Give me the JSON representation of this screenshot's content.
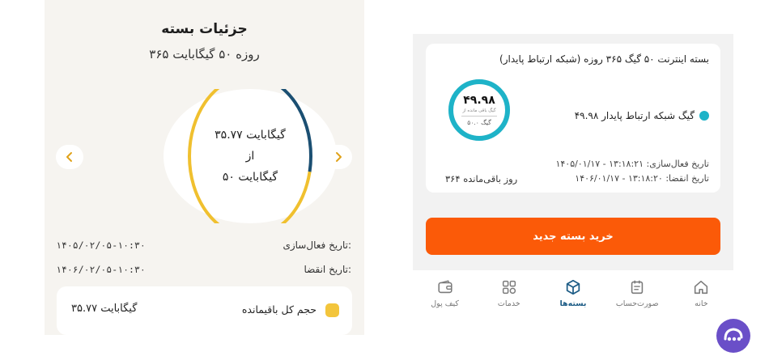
{
  "left": {
    "title": "جزئیات بسته",
    "subtitle": "۳۶۵ روزه ۵۰ گیگابایت",
    "ring": {
      "remaining_text": "۳۵.۷۷ گیگابایت",
      "of_text": "از",
      "total_text": "۵۰ گیگابایت",
      "remaining_fraction": 0.715,
      "used_color": "#1b4f72",
      "remaining_color": "#f0c02f"
    },
    "activation": {
      "label": "تاریخ فعال‌سازی:",
      "value": "۱۴۰۵/۰۲/۰۵-۱۰:۳۰"
    },
    "expiry": {
      "label": "تاریخ انقضا:",
      "value": "۱۴۰۶/۰۲/۰۵-۱۰:۳۰"
    },
    "volume": {
      "label": "حجم کل باقیمانده",
      "value": "۳۵.۷۷ گیگابایت"
    }
  },
  "right": {
    "package_title": "بسته اینترنت ۵۰ گیگ ۳۶۵ روزه (شبکه ارتباط پایدار)",
    "remaining": {
      "value": "۴۹.۹۸",
      "caption": "گیگ باقی مانده از",
      "total": "۵۰.۰ گیگ",
      "fraction": 0.9996,
      "color": "#1eb3c8"
    },
    "legend": "۴۹.۹۸ گیگ شبکه ارتباط پایدار",
    "days_left": "۳۶۴ روز باقی‌مانده",
    "activation": "تاریخ فعال‌سازی: ۱۳:۱۸:۲۱ - ۱۴۰۵/۰۱/۱۷",
    "expiry": "تاریخ انقضا: ۱۳:۱۸:۲۰ - ۱۴۰۶/۰۱/۱۷",
    "buy_button": "خرید بسته جدید",
    "accent_color": "#fb5a08",
    "nav": [
      {
        "label": "خانه",
        "icon": "home-icon"
      },
      {
        "label": "صورت‌حساب",
        "icon": "invoice-icon"
      },
      {
        "label": "بسته‌ها",
        "icon": "package-icon",
        "active": true
      },
      {
        "label": "خدمات",
        "icon": "services-grid-icon"
      },
      {
        "label": "کیف پول",
        "icon": "wallet-icon"
      }
    ]
  }
}
